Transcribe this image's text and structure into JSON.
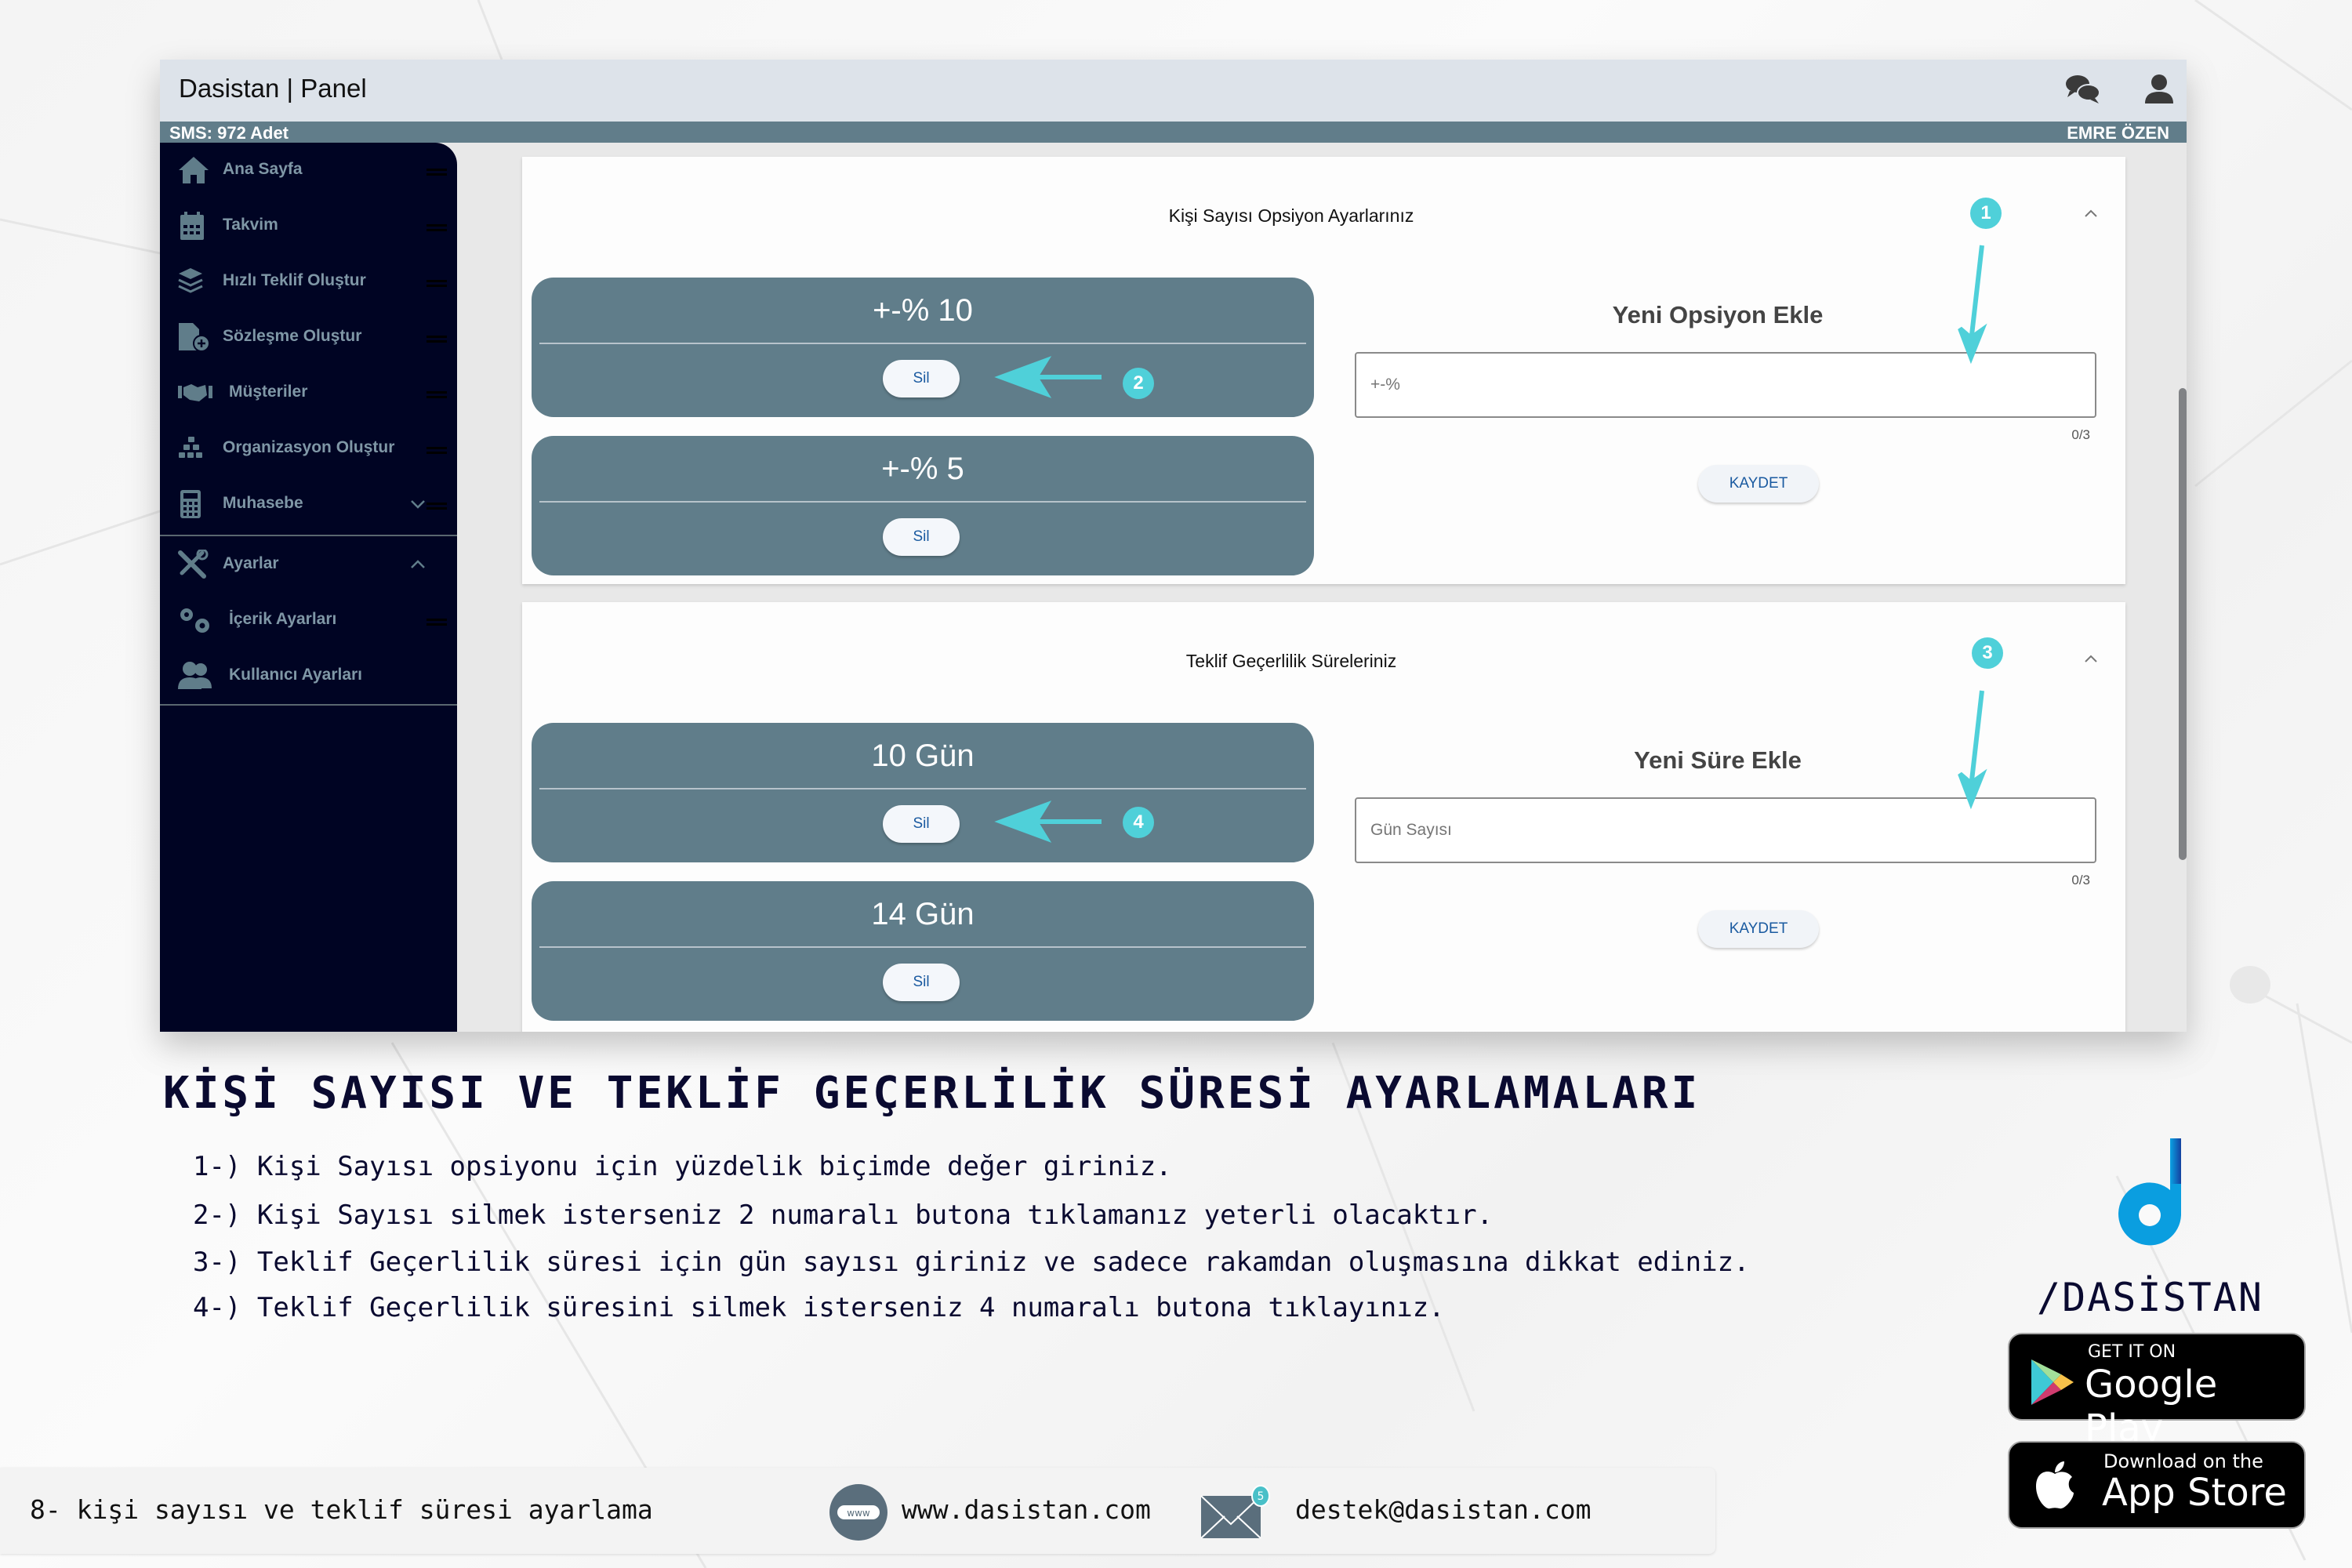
{
  "app": {
    "title": "Dasistan | Panel",
    "sms_count": "SMS: 972 Adet",
    "user_name": "EMRE ÖZEN"
  },
  "sidebar": {
    "items": [
      {
        "label": "Ana Sayfa",
        "icon": "home-icon"
      },
      {
        "label": "Takvim",
        "icon": "calendar-icon"
      },
      {
        "label": "Hızlı Teklif Oluştur",
        "icon": "layers-icon"
      },
      {
        "label": "Sözleşme Oluştur",
        "icon": "file-plus-icon"
      },
      {
        "label": "Müşteriler",
        "icon": "handshake-icon"
      },
      {
        "label": "Organizasyon Oluştur",
        "icon": "cubes-icon"
      },
      {
        "label": "Muhasebe",
        "icon": "calculator-icon",
        "expandable": true,
        "expanded": false
      },
      {
        "label": "Ayarlar",
        "icon": "tools-icon",
        "expandable": true,
        "expanded": true
      },
      {
        "label": "İçerik Ayarları",
        "icon": "gears-icon"
      },
      {
        "label": "Kullanıcı Ayarları",
        "icon": "users-icon"
      }
    ]
  },
  "sections": [
    {
      "title": "Kişi Sayısı Opsiyon Ayarlarınız",
      "options": [
        {
          "value": "+-% 10",
          "delete_label": "Sil"
        },
        {
          "value": "+-% 5",
          "delete_label": "Sil"
        }
      ],
      "form": {
        "title": "Yeni Opsiyon Ekle",
        "input_value": "",
        "input_placeholder": "+-%",
        "counter": "0/3",
        "save_label": "KAYDET"
      }
    },
    {
      "title": "Teklif Geçerlilik Süreleriniz",
      "options": [
        {
          "value": "10 Gün",
          "delete_label": "Sil"
        },
        {
          "value": "14 Gün",
          "delete_label": "Sil"
        }
      ],
      "form": {
        "title": "Yeni Süre Ekle",
        "input_value": "",
        "input_placeholder": "Gün Sayısı",
        "counter": "0/3",
        "save_label": "KAYDET"
      }
    }
  ],
  "annotations": [
    "1",
    "2",
    "3",
    "4"
  ],
  "instructions": {
    "title": "KİŞİ SAYISI VE TEKLİF GEÇERLİLİK SÜRESİ AYARLAMALARI",
    "steps": [
      "1-) Kişi Sayısı opsiyonu için yüzdelik biçimde değer giriniz.",
      "2-) Kişi Sayısı silmek isterseniz 2 numaralı butona tıklamanız yeterli olacaktır.",
      "3-) Teklif Geçerlilik süresi için gün sayısı giriniz ve sadece rakamdan oluşmasına dikkat ediniz.",
      "4-) Teklif Geçerlilik süresini silmek isterseniz 4 numaralı butona tıklayınız."
    ]
  },
  "brand": {
    "name": "/DASİSTAN",
    "google_play": {
      "small": "GET IT ON",
      "big": "Google Play"
    },
    "app_store": {
      "small": "Download on the",
      "big": "App Store"
    }
  },
  "footer": {
    "caption": "8- kişi sayısı ve teklif süresi ayarlama",
    "website": "www.dasistan.com",
    "email": "destek@dasistan.com",
    "www_icon_label": "www",
    "mail_badge": "5"
  },
  "colors": {
    "sidebar_bg": "#000423",
    "header_bg": "#dde3ea",
    "accent_bar": "#617d8a",
    "option_card": "#607d8a",
    "annotation": "#4fd0d9",
    "brand_blue": "#0a9ee0"
  }
}
